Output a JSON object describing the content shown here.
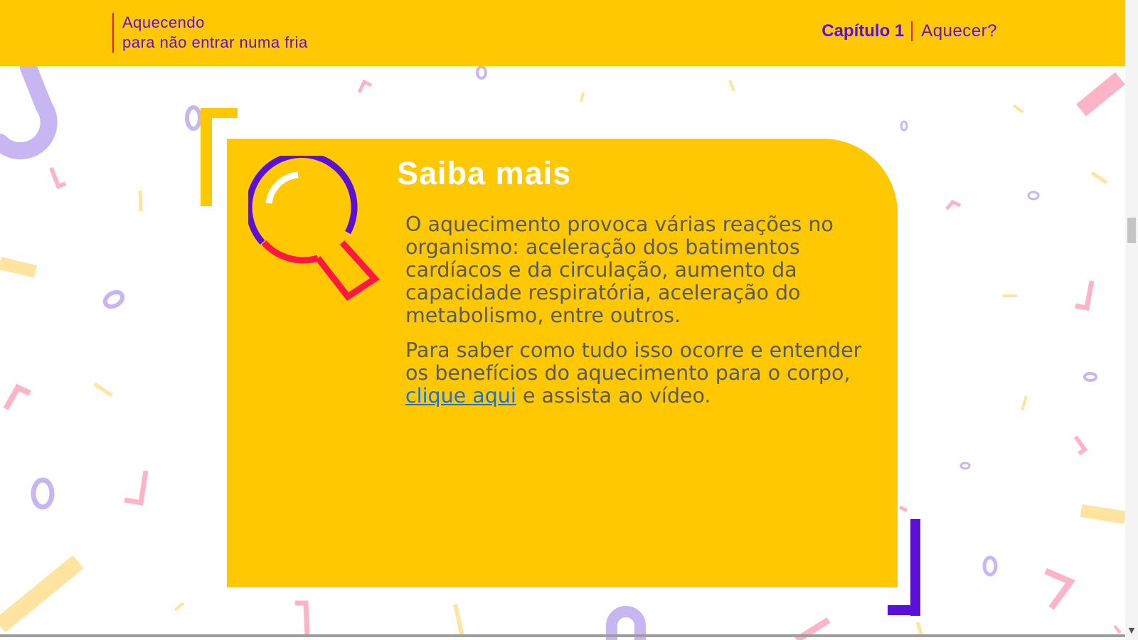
{
  "header": {
    "brand_line1": "Aquecendo",
    "brand_line2": "para não entrar numa fria",
    "chapter_number": "Capítulo 1",
    "chapter_title": "Aquecer?"
  },
  "card": {
    "title": "Saiba mais",
    "paragraph1": "O aquecimento provoca várias reações no organismo: aceleração dos batimentos cardíacos e da circulação, aumento da capacidade respiratória, aceleração do metabolismo, entre outros.",
    "paragraph2_before": "Para saber como tudo isso ocorre e entender os benefícios do aquecimento para o corpo, ",
    "link_text": "clique aqui",
    "paragraph2_after": " e assista ao vídeo."
  },
  "colors": {
    "yellow": "#ffc800",
    "purple": "#5a10d6",
    "red": "#e8184a",
    "link": "#1a6fd8"
  },
  "icons": [
    "magnifier-icon",
    "chevron-down-icon"
  ]
}
